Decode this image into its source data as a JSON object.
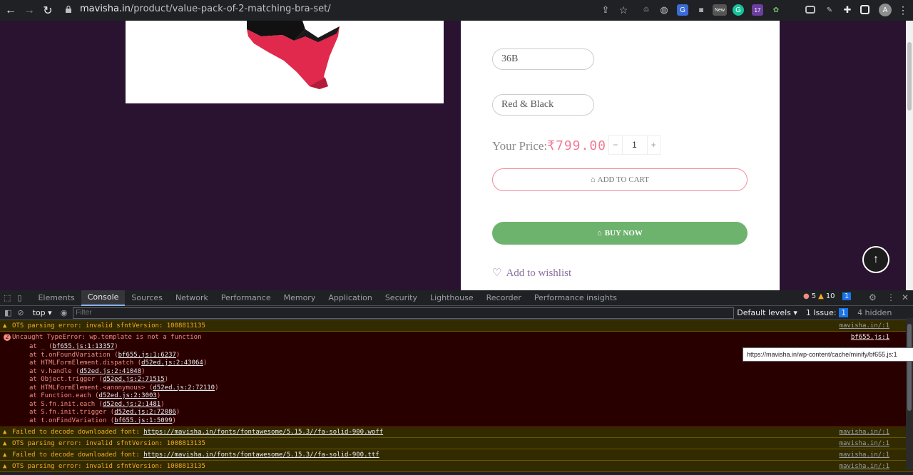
{
  "browser": {
    "url_host": "mavisha.in",
    "url_path": "/product/value-pack-of-2-matching-bra-set/",
    "profile_initial": "A",
    "ext_badge_17": "17",
    "ext_badge_new": "New"
  },
  "product": {
    "size_value": "36B",
    "color_value": "Red & Black",
    "price_label": "Your Price:",
    "price_amount": "₹799.00",
    "quantity": "1",
    "qty_minus": "−",
    "qty_plus": "+",
    "add_to_cart": "ADD TO CART",
    "buy_now": "BUY NOW",
    "wishlist": "Add to wishlist",
    "back_to_top": "↑"
  },
  "devtools": {
    "tabs": [
      "Elements",
      "Console",
      "Sources",
      "Network",
      "Performance",
      "Memory",
      "Application",
      "Security",
      "Lighthouse",
      "Recorder",
      "Performance insights"
    ],
    "selected_tab": "Console",
    "error_count": "5",
    "warning_count": "10",
    "message_count": "1",
    "context": "top",
    "filter_placeholder": "Filter",
    "default_levels": "Default levels",
    "issues_label": "1 Issue:",
    "issues_count": "1",
    "hidden_label": "4 hidden",
    "log": {
      "w1_text": "OTS parsing error: invalid sfntVersion: 1008813135",
      "w1_src": "mavisha.in/:1",
      "err_count": "2",
      "err_text": "Uncaught TypeError: wp.template is not a function",
      "err_src": "bf655.js:1",
      "stack": [
        {
          "pre": "at _ (",
          "link": "bf655.js:1:13357",
          "post": ")"
        },
        {
          "pre": "at t.onFoundVariation (",
          "link": "bf655.js:1:6237",
          "post": ")"
        },
        {
          "pre": "at HTMLFormElement.dispatch (",
          "link": "d52ed.js:2:43064",
          "post": ")"
        },
        {
          "pre": "at v.handle (",
          "link": "d52ed.js:2:41048",
          "post": ")"
        },
        {
          "pre": "at Object.trigger (",
          "link": "d52ed.js:2:71515",
          "post": ")"
        },
        {
          "pre": "at HTMLFormElement.<anonymous> (",
          "link": "d52ed.js:2:72110",
          "post": ")"
        },
        {
          "pre": "at Function.each (",
          "link": "d52ed.js:2:3003",
          "post": ")"
        },
        {
          "pre": "at S.fn.init.each (",
          "link": "d52ed.js:2:1481",
          "post": ")"
        },
        {
          "pre": "at S.fn.init.trigger (",
          "link": "d52ed.js:2:72086",
          "post": ")"
        },
        {
          "pre": "at t.onFindVariation (",
          "link": "bf655.js:1:5099",
          "post": ")"
        }
      ],
      "w2_text": "Failed to decode downloaded font: ",
      "w2_link": "https://mavisha.in/fonts/fontawesome/5.15.3//fa-solid-900.woff",
      "w2_src": "mavisha.in/:1",
      "w3_text": "OTS parsing error: invalid sfntVersion: 1008813135",
      "w3_src": "mavisha.in/:1",
      "w4_text": "Failed to decode downloaded font: ",
      "w4_link": "https://mavisha.in/fonts/fontawesome/5.15.3//fa-solid-900.ttf",
      "w4_src": "mavisha.in/:1",
      "w5_text": "OTS parsing error: invalid sfntVersion: 1008813135",
      "w5_src": "mavisha.in/:1"
    },
    "tooltip": "https://mavisha.in/wp-content/cache/minify/bf655.js:1"
  },
  "colors": {
    "page_bg": "#2a1330",
    "price": "#f27b94",
    "buy_now_bg": "#6db36d",
    "cart_border": "#f48ca0"
  }
}
